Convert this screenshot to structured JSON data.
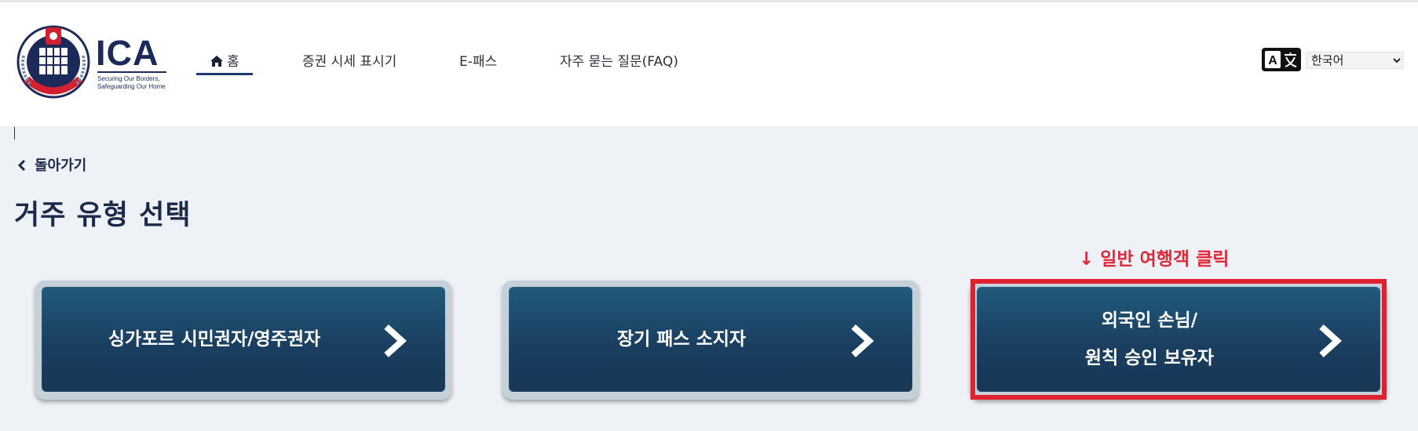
{
  "logo": {
    "wordmark": "ICA",
    "tagline_1": "Securing Our Borders,",
    "tagline_2": "Safeguarding Our Home"
  },
  "nav": {
    "items": [
      {
        "label": "홈",
        "icon": "home-icon",
        "active": true
      },
      {
        "label": "증권 시세 표시기"
      },
      {
        "label": "E-패스"
      },
      {
        "label": "자주 묻는 질문(FAQ)"
      }
    ]
  },
  "language": {
    "icon": "translate-icon",
    "selected": "한국어"
  },
  "back": {
    "label": "돌아가기",
    "icon": "chevron-left-icon"
  },
  "page_title": "거주 유형 선택",
  "hint": "↓ 일반 여행객 클릭",
  "cards": [
    {
      "lines": [
        "싱가포르 시민권자/영주권자"
      ]
    },
    {
      "lines": [
        "장기 패스 소지자"
      ]
    },
    {
      "lines": [
        "외국인 손님/",
        "원칙 승인 보유자"
      ],
      "highlighted": true
    }
  ],
  "colors": {
    "card": "#1a3f60",
    "highlight": "#e0202f",
    "title": "#1c2a4a",
    "nav_active_underline": "#1d3b6e"
  }
}
